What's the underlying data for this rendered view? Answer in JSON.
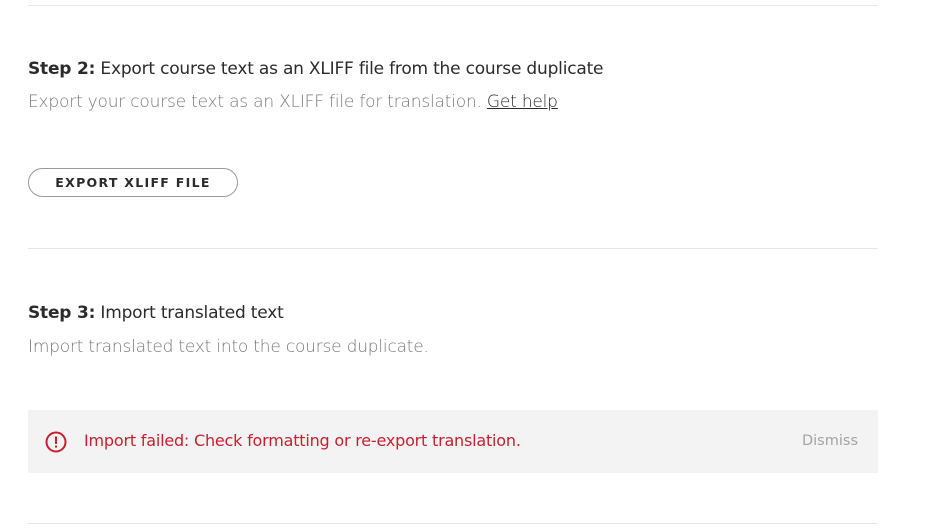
{
  "step2": {
    "label": "Step 2:",
    "title": " Export course text as an XLIFF file from the course duplicate",
    "description": "Export your course text as an XLIFF file for translation. ",
    "help_link": "Get help",
    "button_label": "EXPORT XLIFF FILE"
  },
  "step3": {
    "label": "Step 3:",
    "title": " Import translated text",
    "description": "Import translated text into the course duplicate."
  },
  "alert": {
    "icon": "error-circle-icon",
    "message": "Import failed: Check formatting or re-export translation.",
    "dismiss_label": "Dismiss",
    "color": "#c8202f",
    "background": "#f3f3f3"
  }
}
